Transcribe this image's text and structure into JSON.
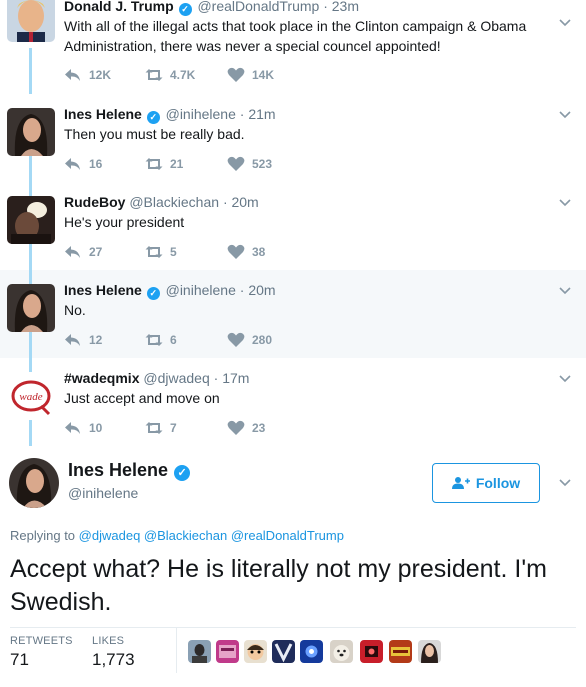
{
  "tweets": [
    {
      "name": "Donald J. Trump",
      "handle": "@realDonaldTrump",
      "time": "· 23m",
      "text": "With all of the illegal acts that took place in the Clinton campaign & Obama Administration, there was never a special councel appointed!",
      "replies": "12K",
      "retweets": "4.7K",
      "likes": "14K"
    },
    {
      "name": "Ines Helene",
      "handle": "@inihelene",
      "time": "· 21m",
      "text": "Then you must be really bad.",
      "replies": "16",
      "retweets": "21",
      "likes": "523"
    },
    {
      "name": "RudeBoy",
      "handle": "@Blackiechan",
      "time": "· 20m",
      "text": "He's your president",
      "replies": "27",
      "retweets": "5",
      "likes": "38"
    },
    {
      "name": "Ines Helene",
      "handle": "@inihelene",
      "time": "· 20m",
      "text": "No.",
      "replies": "12",
      "retweets": "6",
      "likes": "280"
    },
    {
      "name": "#wadeqmix",
      "handle": "@djwadeq",
      "time": "· 17m",
      "text": "Just accept and move on",
      "replies": "10",
      "retweets": "7",
      "likes": "23"
    }
  ],
  "main": {
    "name": "Ines Helene",
    "handle": "@inihelene",
    "follow_label": "Follow",
    "replying_prefix": "Replying to",
    "mentions": "@djwadeq @Blackiechan @realDonaldTrump",
    "text": "Accept what? He is literally not my president. I'm Swedish.",
    "retweets_label": "RETWEETS",
    "retweets_value": "71",
    "likes_label": "LIKES",
    "likes_value": "1,773"
  },
  "colors": {
    "accent": "#1da1f2",
    "link": "#1b95e0",
    "thread_line": "#a4d9f5",
    "muted": "#8899a6",
    "shaded_bg": "#f5f8fa"
  },
  "wade_logo_text": "wade"
}
